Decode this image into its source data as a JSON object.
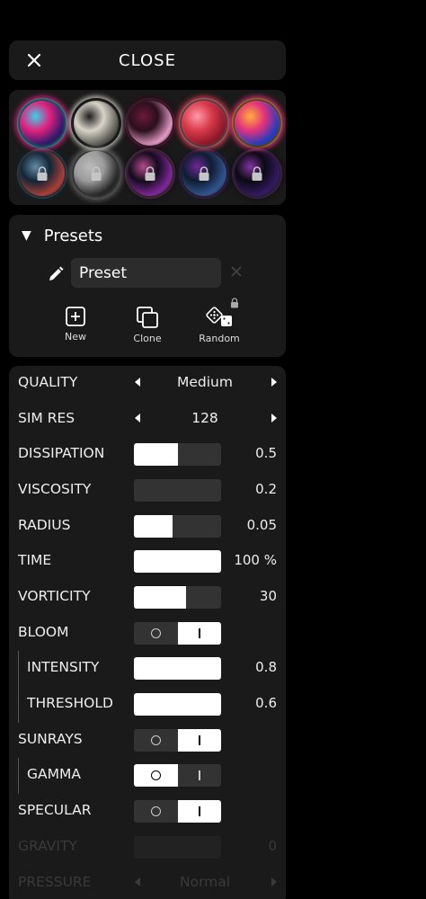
{
  "close_bar": {
    "title": "CLOSE"
  },
  "thumbnails": [
    {
      "name": "fluid-preset-1",
      "locked": false,
      "colors": [
        "#e3207e",
        "#2a1a6b",
        "#3ad1e8"
      ]
    },
    {
      "name": "fluid-preset-2",
      "locked": false,
      "colors": [
        "#d8d4c8",
        "#5a5a52",
        "#1e1e1e"
      ]
    },
    {
      "name": "fluid-preset-3",
      "locked": false,
      "colors": [
        "#2a0f1c",
        "#e29ac4",
        "#6b1a38"
      ]
    },
    {
      "name": "fluid-preset-4",
      "locked": false,
      "colors": [
        "#d93b4c",
        "#8a1727",
        "#ff9aa8"
      ]
    },
    {
      "name": "fluid-preset-5",
      "locked": false,
      "colors": [
        "#e3317b",
        "#1f3cc0",
        "#ffb03a"
      ]
    },
    {
      "name": "fluid-preset-6",
      "locked": true,
      "colors": [
        "#0e2a40",
        "#d84a40",
        "#7fb0d6"
      ]
    },
    {
      "name": "fluid-preset-7",
      "locked": true,
      "colors": [
        "#c8c8c8",
        "#2a2a2a",
        "#f0f0f0"
      ]
    },
    {
      "name": "fluid-preset-8",
      "locked": true,
      "colors": [
        "#12061f",
        "#9e2cc0",
        "#e85cb0"
      ]
    },
    {
      "name": "fluid-preset-9",
      "locked": true,
      "colors": [
        "#0b1e3a",
        "#3a69b8",
        "#8b2cc0"
      ]
    },
    {
      "name": "fluid-preset-10",
      "locked": true,
      "colors": [
        "#080510",
        "#3b1a7a",
        "#a53dd1"
      ]
    }
  ],
  "presets": {
    "header": "Presets",
    "name_value": "Preset",
    "buttons": {
      "new": "New",
      "clone": "Clone",
      "random": "Random"
    }
  },
  "settings": {
    "quality": {
      "label": "QUALITY",
      "value": "Medium"
    },
    "sim_res": {
      "label": "SIM RES",
      "value": "128"
    },
    "dissipation": {
      "label": "DISSIPATION",
      "value": "0.5",
      "fill": 0.5
    },
    "viscosity": {
      "label": "VISCOSITY",
      "value": "0.2",
      "fill": 0.0
    },
    "radius": {
      "label": "RADIUS",
      "value": "0.05",
      "fill": 0.44
    },
    "time": {
      "label": "TIME",
      "value": "100 %",
      "fill": 1.0
    },
    "vorticity": {
      "label": "VORTICITY",
      "value": "30",
      "fill": 0.6
    },
    "bloom": {
      "label": "BLOOM",
      "on": true
    },
    "intensity": {
      "label": "INTENSITY",
      "value": "0.8",
      "fill": 1.0
    },
    "threshold": {
      "label": "THRESHOLD",
      "value": "0.6",
      "fill": 1.0
    },
    "sunrays": {
      "label": "SUNRAYS",
      "on": true
    },
    "gamma": {
      "label": "GAMMA",
      "on": false
    },
    "specular": {
      "label": "SPECULAR",
      "on": true
    },
    "gravity": {
      "label": "GRAVITY",
      "value": "0",
      "fill": 0.0
    },
    "pressure": {
      "label": "PRESSURE",
      "value": "Normal"
    }
  }
}
